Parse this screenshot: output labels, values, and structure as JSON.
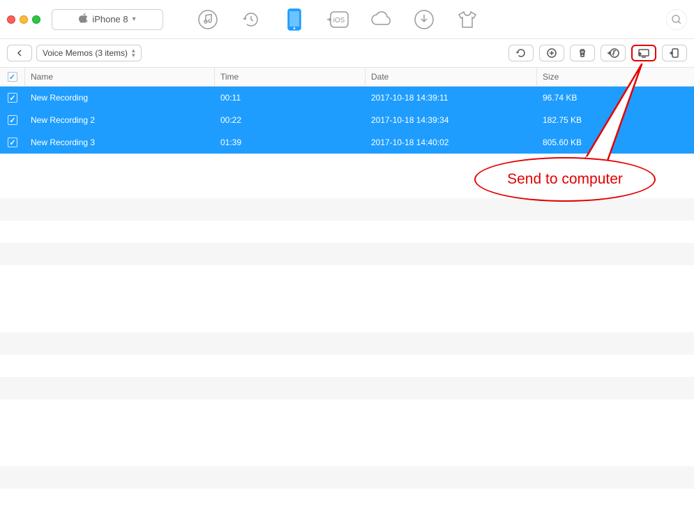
{
  "device": {
    "name": "iPhone 8"
  },
  "breadcrumb": {
    "label": "Voice Memos (3 items)"
  },
  "columns": {
    "name": "Name",
    "time": "Time",
    "date": "Date",
    "size": "Size"
  },
  "rows": [
    {
      "name": "New Recording",
      "time": "00:11",
      "date": "2017-10-18 14:39:11",
      "size": "96.74 KB"
    },
    {
      "name": "New Recording 2",
      "time": "00:22",
      "date": "2017-10-18 14:39:34",
      "size": "182.75 KB"
    },
    {
      "name": "New Recording 3",
      "time": "01:39",
      "date": "2017-10-18 14:40:02",
      "size": "805.60 KB"
    }
  ],
  "nav_icons": [
    "music-icon",
    "history-icon",
    "phone-icon",
    "to-ios-icon",
    "cloud-icon",
    "download-icon",
    "tshirt-icon"
  ],
  "action_icons": [
    "refresh-icon",
    "add-icon",
    "delete-icon",
    "to-itunes-icon",
    "to-computer-icon",
    "to-device-icon"
  ],
  "callout": {
    "text": "Send to computer"
  },
  "colors": {
    "accent": "#1e9dff",
    "highlight": "#e40000"
  }
}
